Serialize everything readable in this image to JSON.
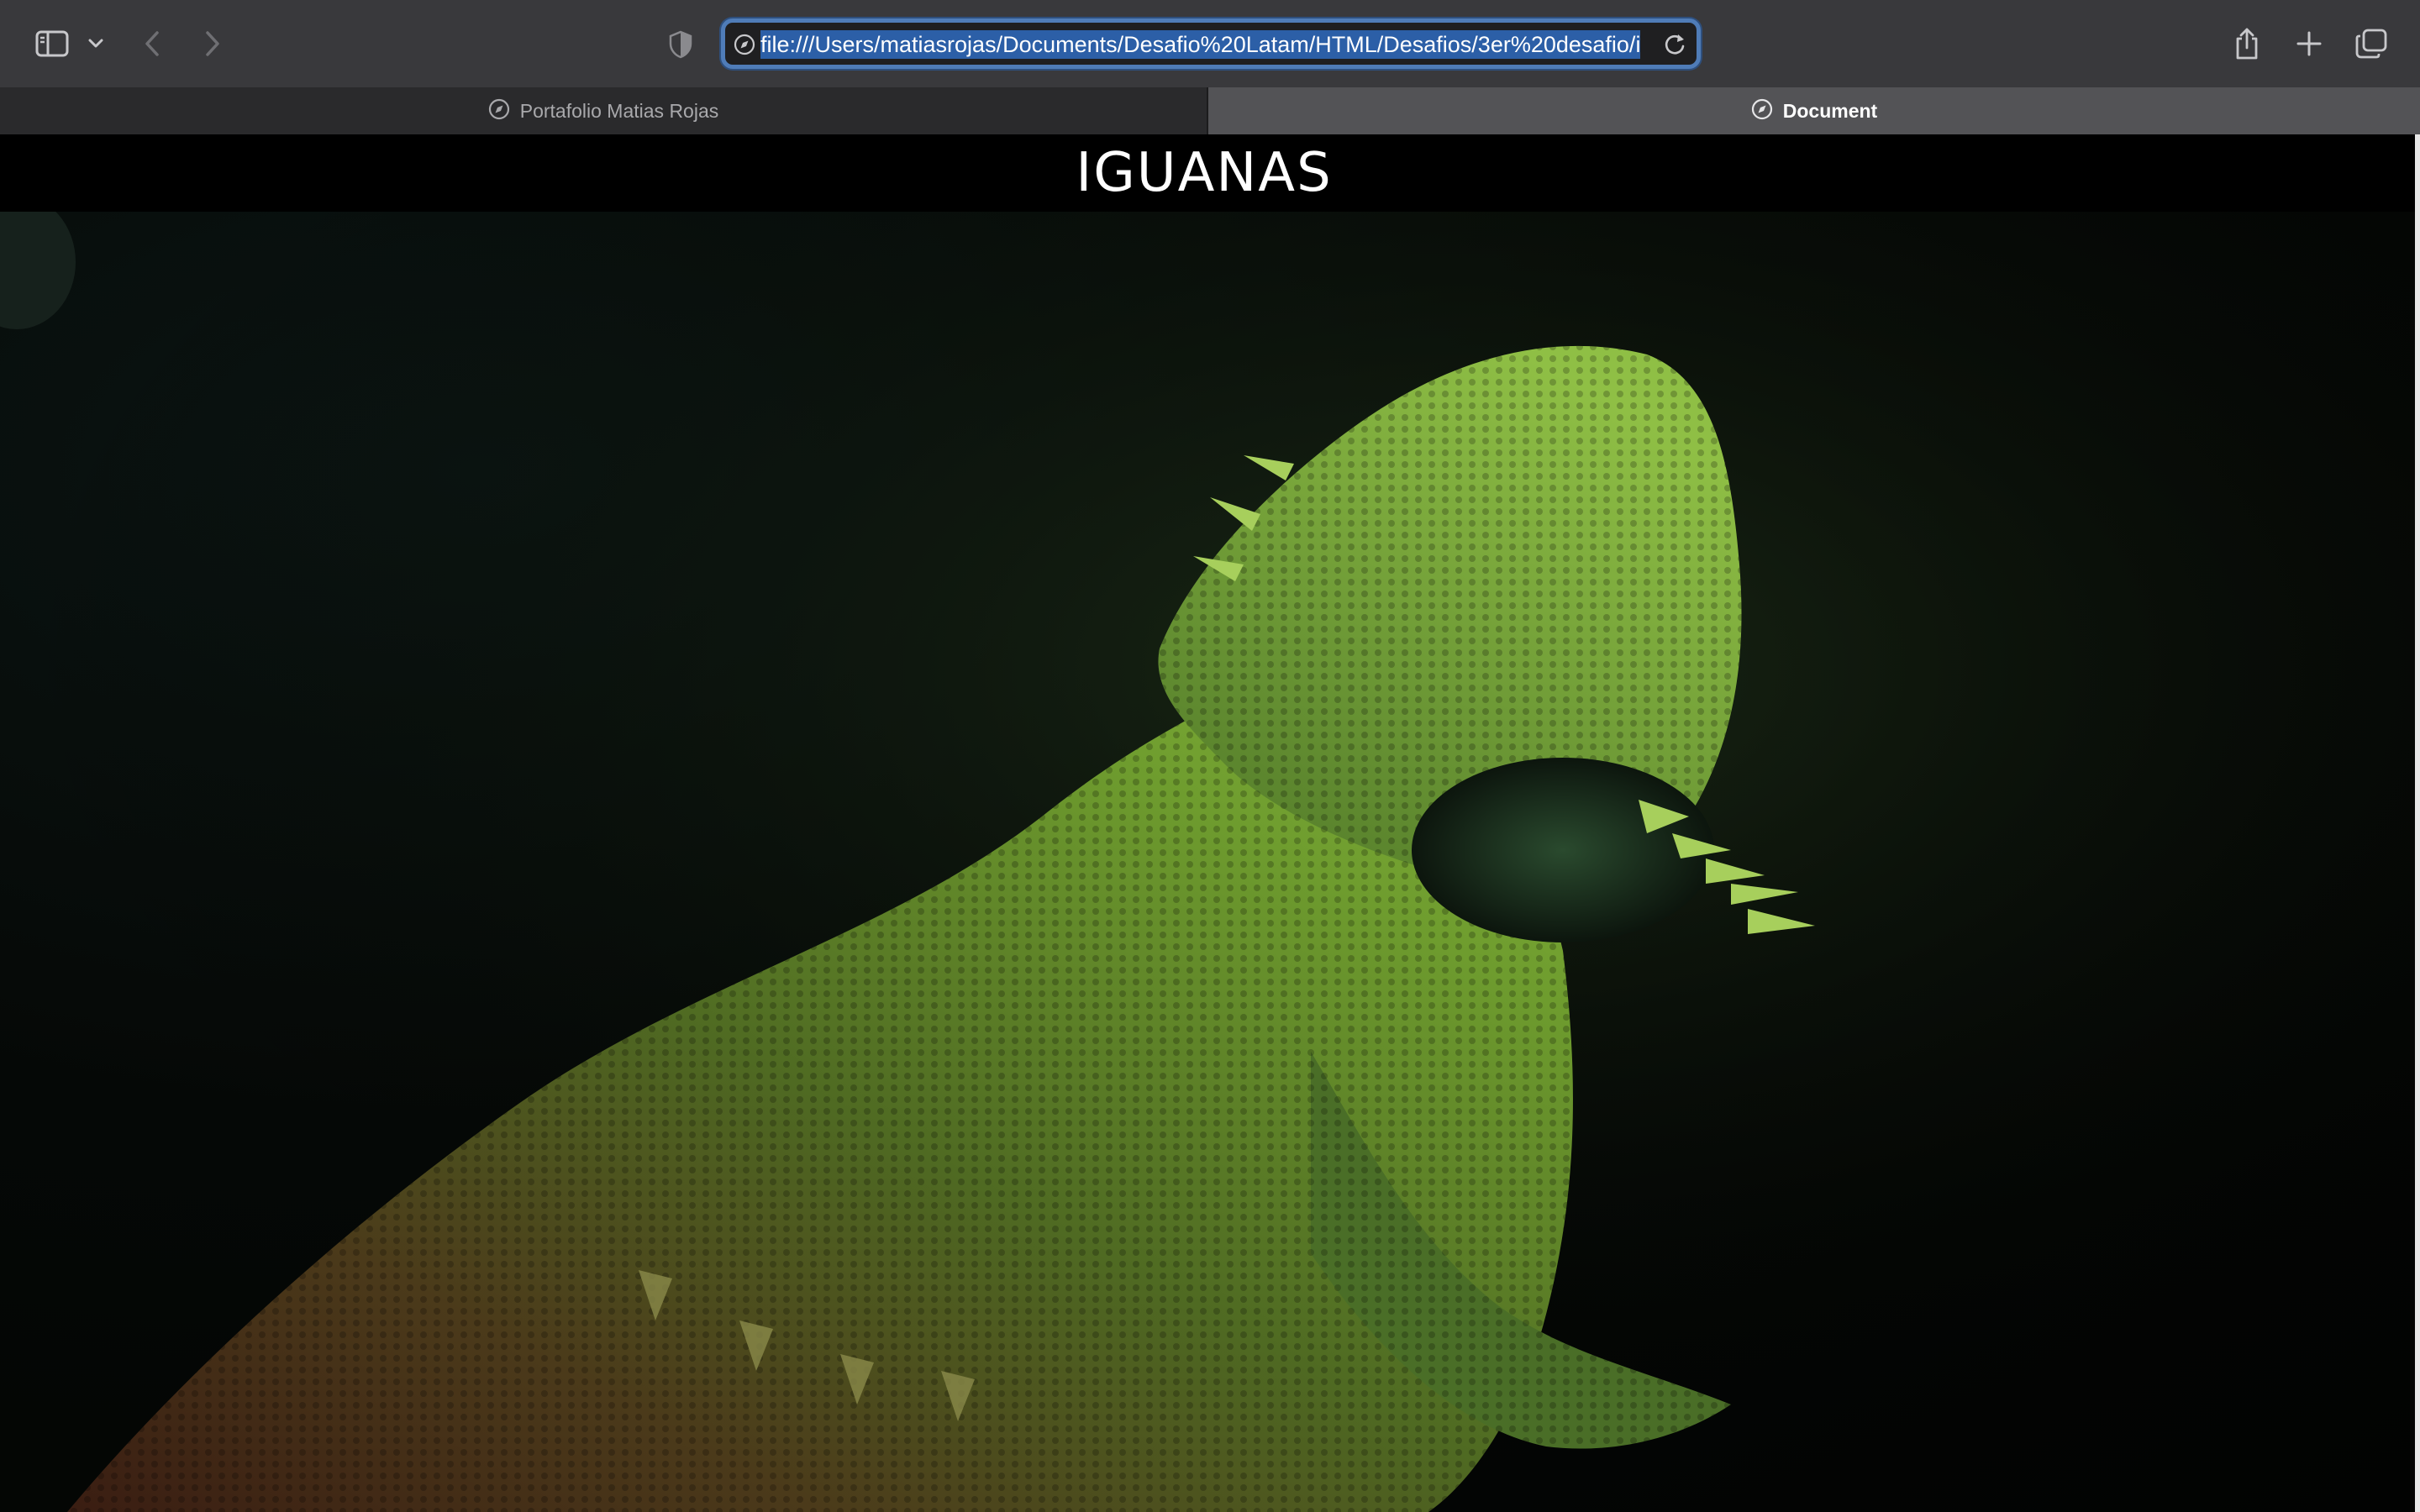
{
  "browser": {
    "url": "file:///Users/matiasrojas/Documents/Desafio%20Latam/HTML/Desafios/3er%20desafio/i",
    "tabs": [
      {
        "label": "Portafolio Matias Rojas",
        "active": false
      },
      {
        "label": "Document",
        "active": true
      }
    ],
    "icons": {
      "sidebar": "sidebar-icon",
      "dropdown": "chevron-down-icon",
      "back": "chevron-left-icon",
      "forward": "chevron-right-icon",
      "privacy": "shield-icon",
      "site": "compass-icon",
      "reload": "reload-icon",
      "share": "share-icon",
      "new_tab": "plus-icon",
      "tab_overview": "tab-overview-icon"
    },
    "accent_color": "#4f7cb8"
  },
  "page": {
    "title": "IGUANAS",
    "hero_image": "green bearded dragon lizard on dark background"
  }
}
